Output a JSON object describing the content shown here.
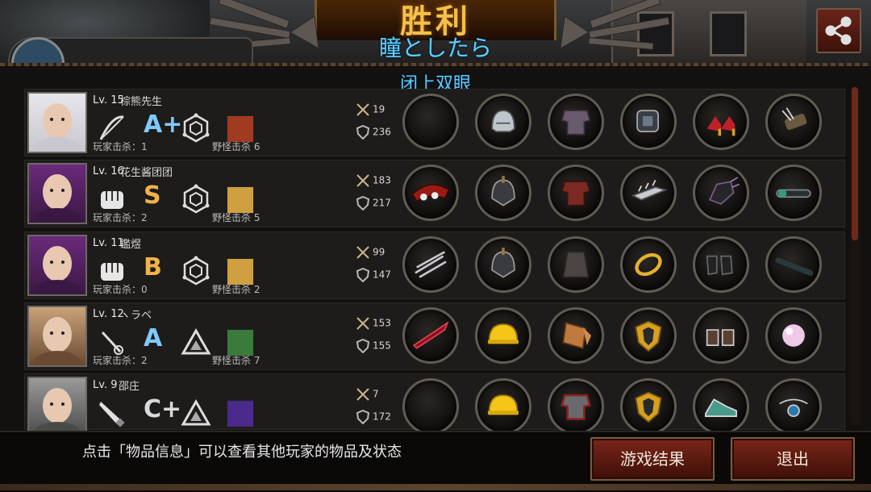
{
  "header": {
    "title": "胜利",
    "subtitle_1": "瞳としたら",
    "subtitle_2": "闭上双眼",
    "top_player_name": "棕熊先生"
  },
  "share_button": {
    "icon": "share-icon"
  },
  "players": [
    {
      "level": "Lv. 15",
      "name": "棕熊先生",
      "grade": "A+",
      "grade_color": "#7fc9ff",
      "weapon_icon": "bow-icon",
      "player_kills": "玩家击杀：1",
      "monster_kills": "野怪击杀 6",
      "attack": "19",
      "defense": "236",
      "items": [
        "empty-slot",
        "helmet-icon",
        "armor-icon",
        "gauntlet-icon",
        "high-heels-icon",
        "quiver-icon"
      ]
    },
    {
      "level": "Lv. 16",
      "name": "花生酱团团",
      "grade": "S",
      "grade_color": "#f0b24a",
      "weapon_icon": "fist-icon",
      "player_kills": "玩家击杀：2",
      "monster_kills": "野怪击杀 5",
      "attack": "183",
      "defense": "217",
      "items": [
        "mask-icon",
        "knight-helmet-icon",
        "red-armor-icon",
        "spiked-arm-guard-icon",
        "claw-glove-icon",
        "scope-icon"
      ]
    },
    {
      "level": "Lv. 11",
      "name": "鑑煜",
      "grade": "B",
      "grade_color": "#f0b24a",
      "weapon_icon": "fist-icon",
      "player_kills": "玩家击杀：0",
      "monster_kills": "野怪击杀 2",
      "attack": "99",
      "defense": "147",
      "items": [
        "claw-icon",
        "knight-helmet-icon",
        "cloak-icon",
        "ring-icon",
        "boots-icon",
        "baton-icon"
      ]
    },
    {
      "level": "Lv. 12",
      "name": "ヽラベ",
      "grade": "A",
      "grade_color": "#7fc9ff",
      "weapon_icon": "rapier-icon",
      "player_kills": "玩家击杀：2",
      "monster_kills": "野怪击杀 7",
      "attack": "153",
      "defense": "155",
      "items": [
        "red-blade-icon",
        "hard-hat-icon",
        "scale-armor-icon",
        "gold-shield-icon",
        "fur-boots-icon",
        "pearl-icon"
      ]
    },
    {
      "level": "Lv. 9",
      "name": "邵庄",
      "grade": "C+",
      "grade_color": "#d9d9d9",
      "weapon_icon": "knife-icon",
      "player_kills": "",
      "monster_kills": "",
      "attack": "7",
      "defense": "172",
      "items": [
        "empty-slot",
        "hard-hat-icon",
        "battle-armor-icon",
        "gold-shield-icon",
        "sneakers-icon",
        "amulet-icon"
      ]
    }
  ],
  "footer": {
    "hint": "点击「物品信息」可以查看其他玩家的物品及状态",
    "results_button": "游戏结果",
    "exit_button": "退出"
  }
}
